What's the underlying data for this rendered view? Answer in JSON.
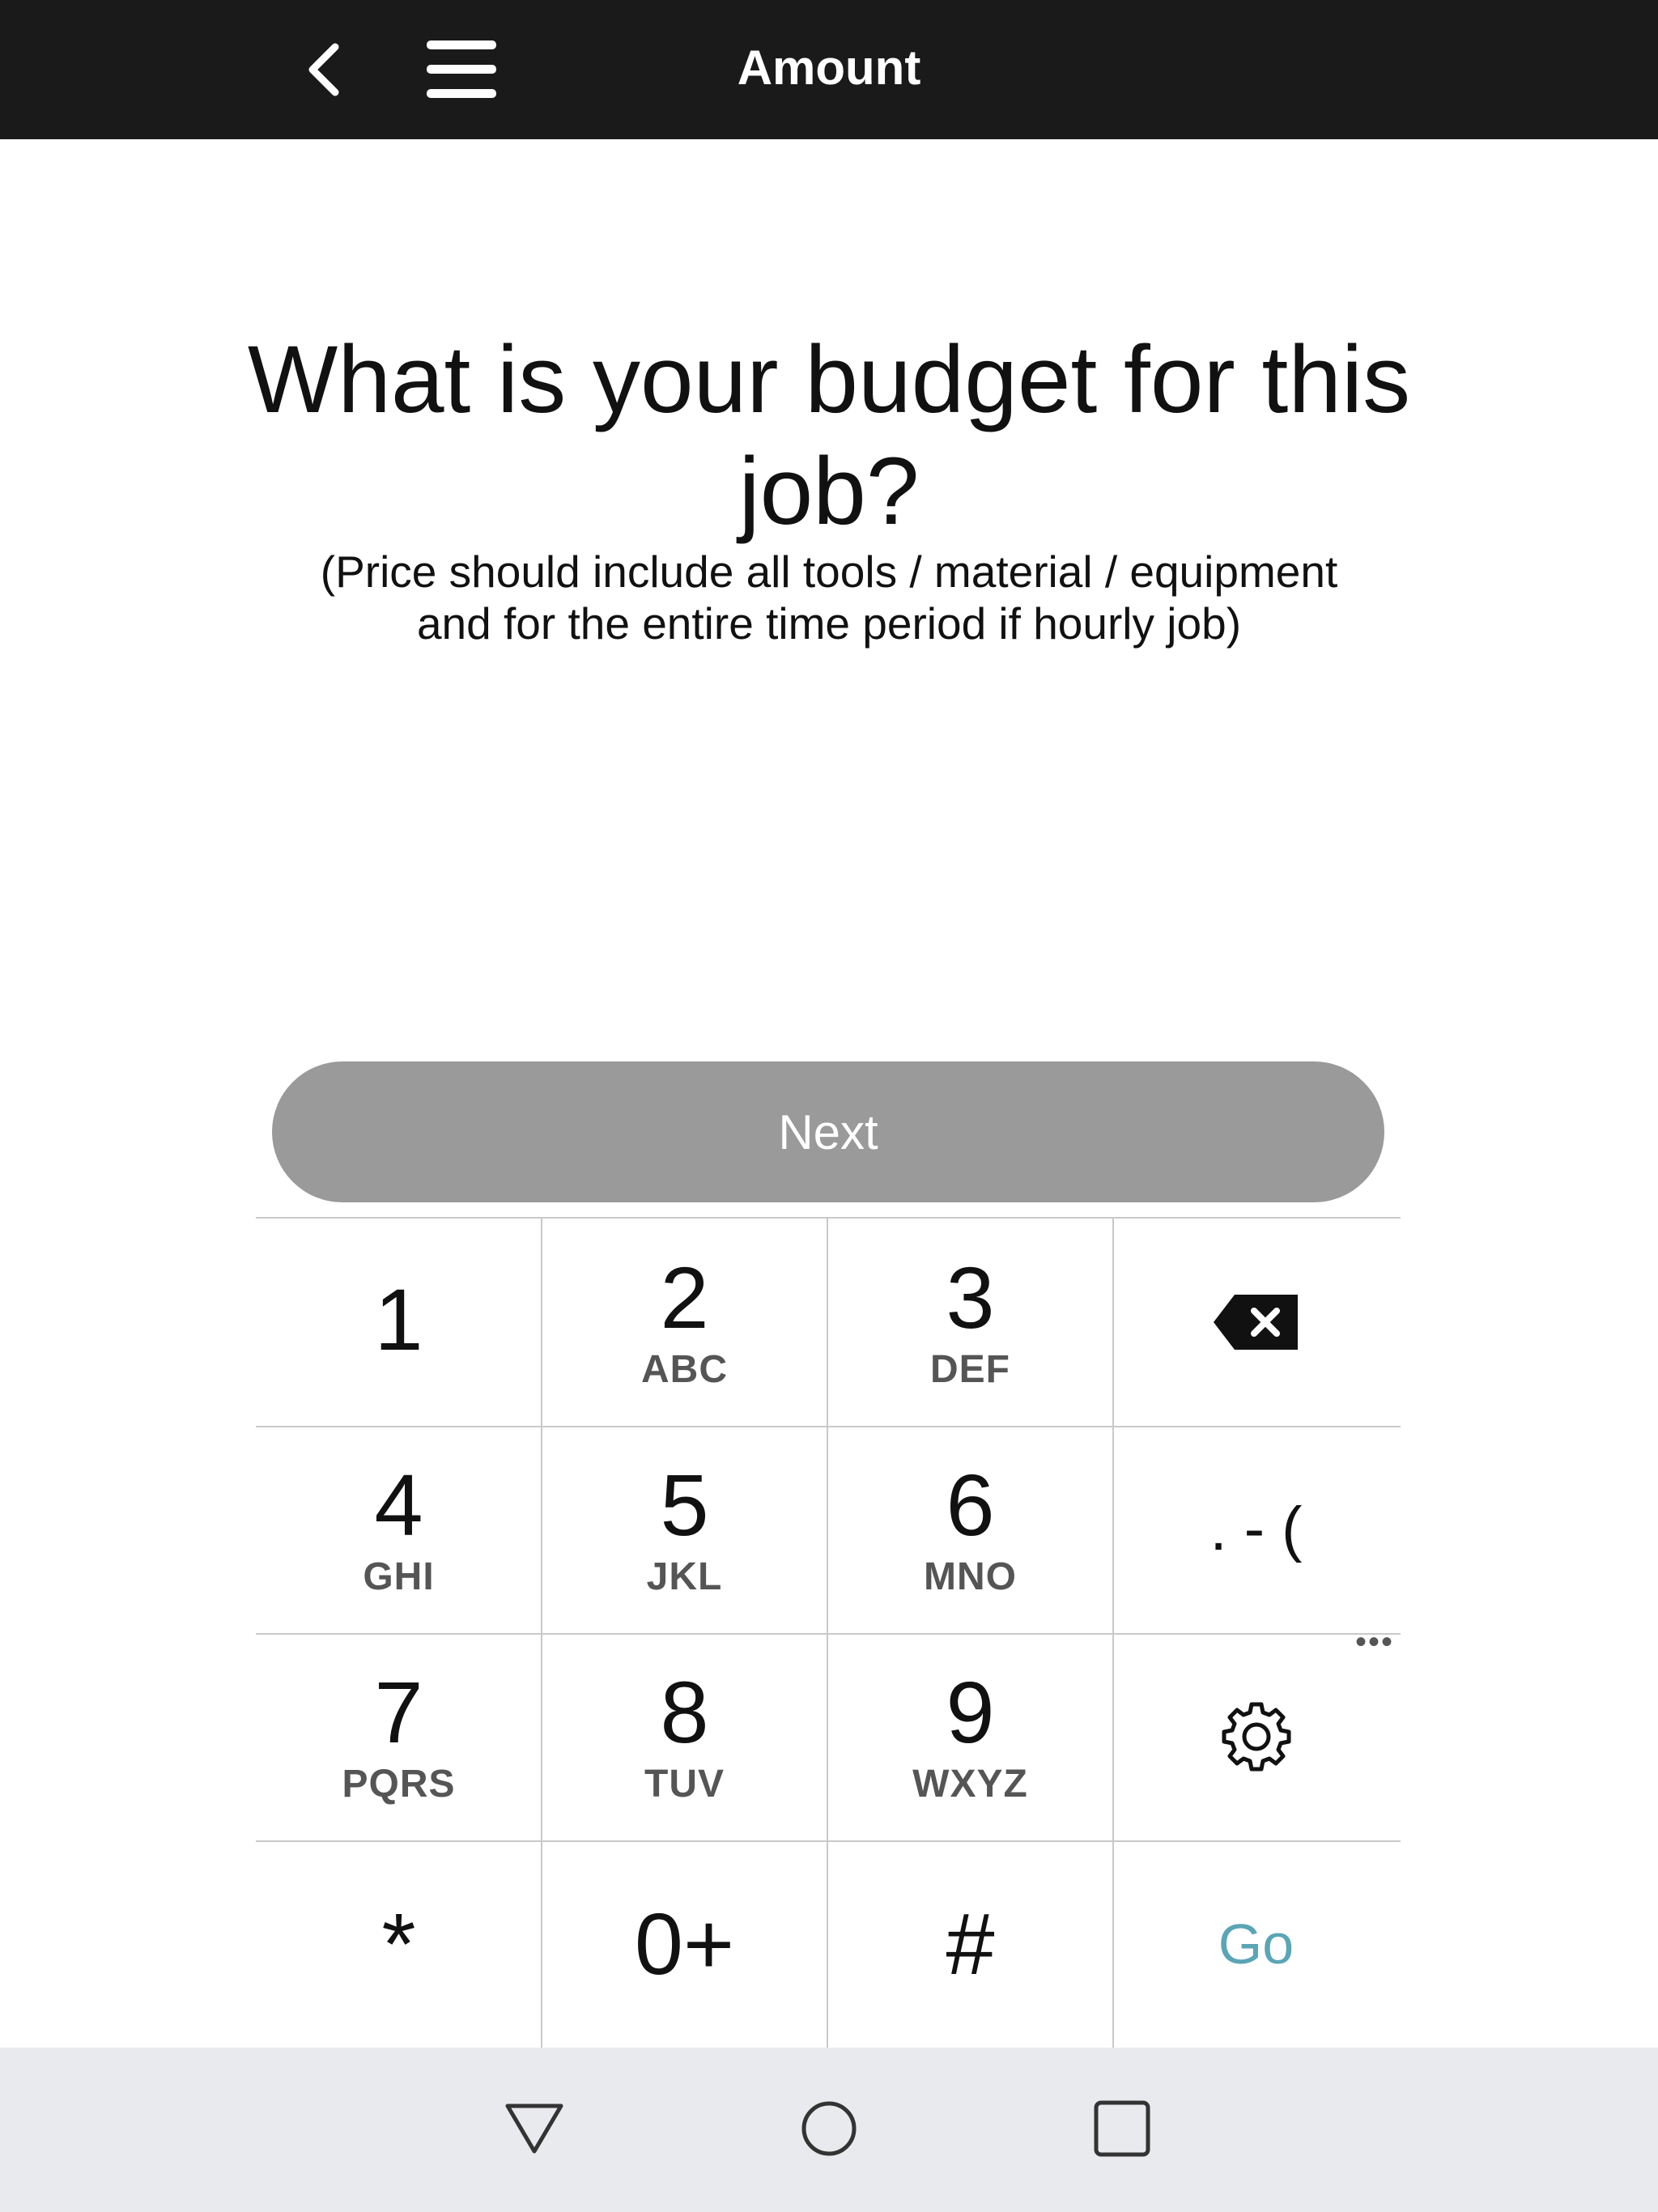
{
  "header": {
    "title": "Amount",
    "back_icon": "chevron-left-icon",
    "menu_icon": "hamburger-menu-icon",
    "background": "#1a1a1a"
  },
  "main": {
    "question": "What is your budget for this job?",
    "hint_line1": "(Price should include all tools / material / equipment",
    "hint_line2": "and for the entire time period if hourly job)",
    "next_label": "Next",
    "next_color": "#9a9a9a"
  },
  "keypad": {
    "keys": [
      {
        "num": "1",
        "letters": ""
      },
      {
        "num": "2",
        "letters": "ABC"
      },
      {
        "num": "3",
        "letters": "DEF"
      },
      {
        "icon": "backspace-icon"
      },
      {
        "num": "4",
        "letters": "GHI"
      },
      {
        "num": "5",
        "letters": "JKL"
      },
      {
        "num": "6",
        "letters": "MNO"
      },
      {
        "symbols": ". - ("
      },
      {
        "num": "7",
        "letters": "PQRS"
      },
      {
        "num": "8",
        "letters": "TUV"
      },
      {
        "num": "9",
        "letters": "WXYZ"
      },
      {
        "icon": "gear-icon"
      },
      {
        "num": "*"
      },
      {
        "num": "0+"
      },
      {
        "num": "#"
      },
      {
        "action": "Go"
      }
    ],
    "more_indicator": "•••",
    "go_color": "#5aa5b6"
  },
  "system_nav": {
    "back_icon": "triangle-back-icon",
    "home_icon": "circle-home-icon",
    "recents_icon": "square-recents-icon"
  }
}
